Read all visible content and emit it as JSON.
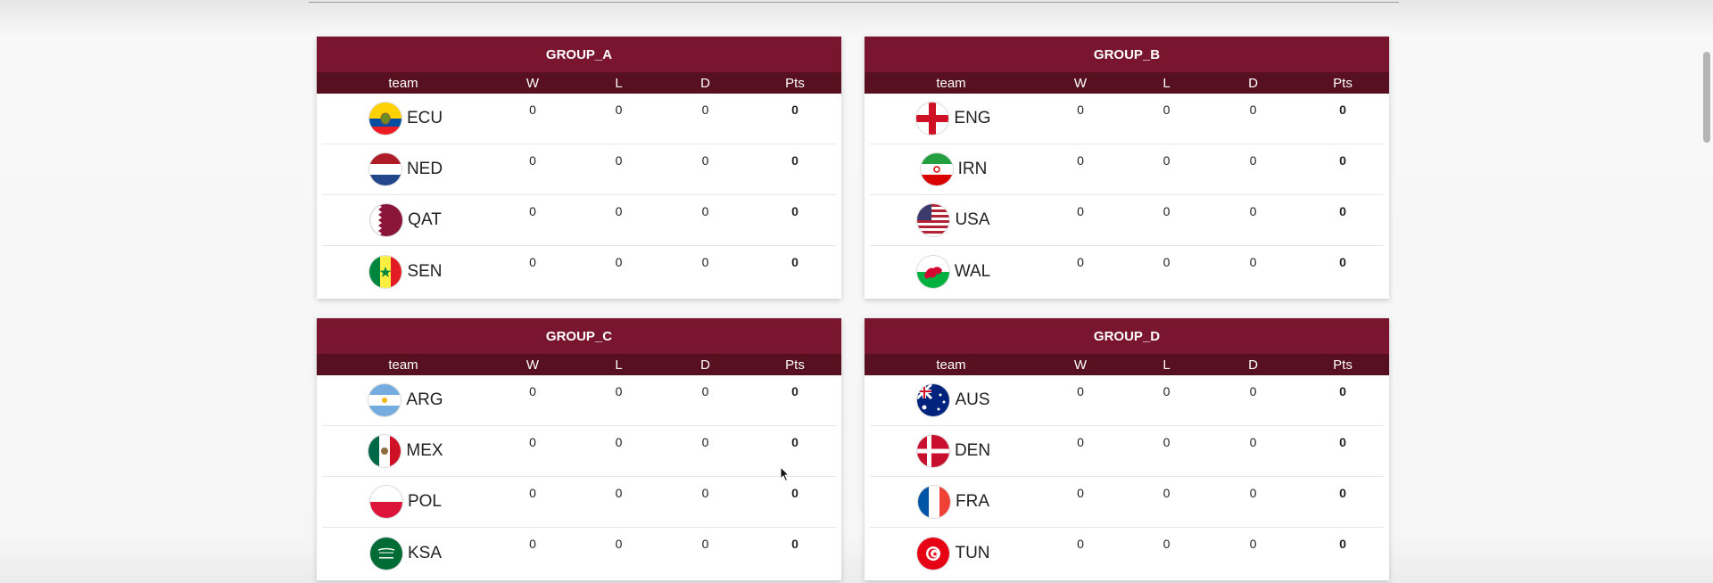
{
  "columns": {
    "team": "team",
    "w": "W",
    "l": "L",
    "d": "D",
    "pts": "Pts"
  },
  "groups": [
    {
      "name": "GROUP_A",
      "teams": [
        {
          "code": "ECU",
          "flag": "ecuador-flag-icon",
          "w": "0",
          "l": "0",
          "d": "0",
          "pts": "0"
        },
        {
          "code": "NED",
          "flag": "netherlands-flag-icon",
          "w": "0",
          "l": "0",
          "d": "0",
          "pts": "0"
        },
        {
          "code": "QAT",
          "flag": "qatar-flag-icon",
          "w": "0",
          "l": "0",
          "d": "0",
          "pts": "0"
        },
        {
          "code": "SEN",
          "flag": "senegal-flag-icon",
          "w": "0",
          "l": "0",
          "d": "0",
          "pts": "0"
        }
      ]
    },
    {
      "name": "GROUP_B",
      "teams": [
        {
          "code": "ENG",
          "flag": "england-flag-icon",
          "w": "0",
          "l": "0",
          "d": "0",
          "pts": "0"
        },
        {
          "code": "IRN",
          "flag": "iran-flag-icon",
          "w": "0",
          "l": "0",
          "d": "0",
          "pts": "0"
        },
        {
          "code": "USA",
          "flag": "usa-flag-icon",
          "w": "0",
          "l": "0",
          "d": "0",
          "pts": "0"
        },
        {
          "code": "WAL",
          "flag": "wales-flag-icon",
          "w": "0",
          "l": "0",
          "d": "0",
          "pts": "0"
        }
      ]
    },
    {
      "name": "GROUP_C",
      "teams": [
        {
          "code": "ARG",
          "flag": "argentina-flag-icon",
          "w": "0",
          "l": "0",
          "d": "0",
          "pts": "0"
        },
        {
          "code": "MEX",
          "flag": "mexico-flag-icon",
          "w": "0",
          "l": "0",
          "d": "0",
          "pts": "0"
        },
        {
          "code": "POL",
          "flag": "poland-flag-icon",
          "w": "0",
          "l": "0",
          "d": "0",
          "pts": "0"
        },
        {
          "code": "KSA",
          "flag": "saudi-arabia-flag-icon",
          "w": "0",
          "l": "0",
          "d": "0",
          "pts": "0"
        }
      ]
    },
    {
      "name": "GROUP_D",
      "teams": [
        {
          "code": "AUS",
          "flag": "australia-flag-icon",
          "w": "0",
          "l": "0",
          "d": "0",
          "pts": "0"
        },
        {
          "code": "DEN",
          "flag": "denmark-flag-icon",
          "w": "0",
          "l": "0",
          "d": "0",
          "pts": "0"
        },
        {
          "code": "FRA",
          "flag": "france-flag-icon",
          "w": "0",
          "l": "0",
          "d": "0",
          "pts": "0"
        },
        {
          "code": "TUN",
          "flag": "tunisia-flag-icon",
          "w": "0",
          "l": "0",
          "d": "0",
          "pts": "0"
        }
      ]
    }
  ],
  "colors": {
    "header": "#7a1530",
    "subheader": "#56101f"
  }
}
